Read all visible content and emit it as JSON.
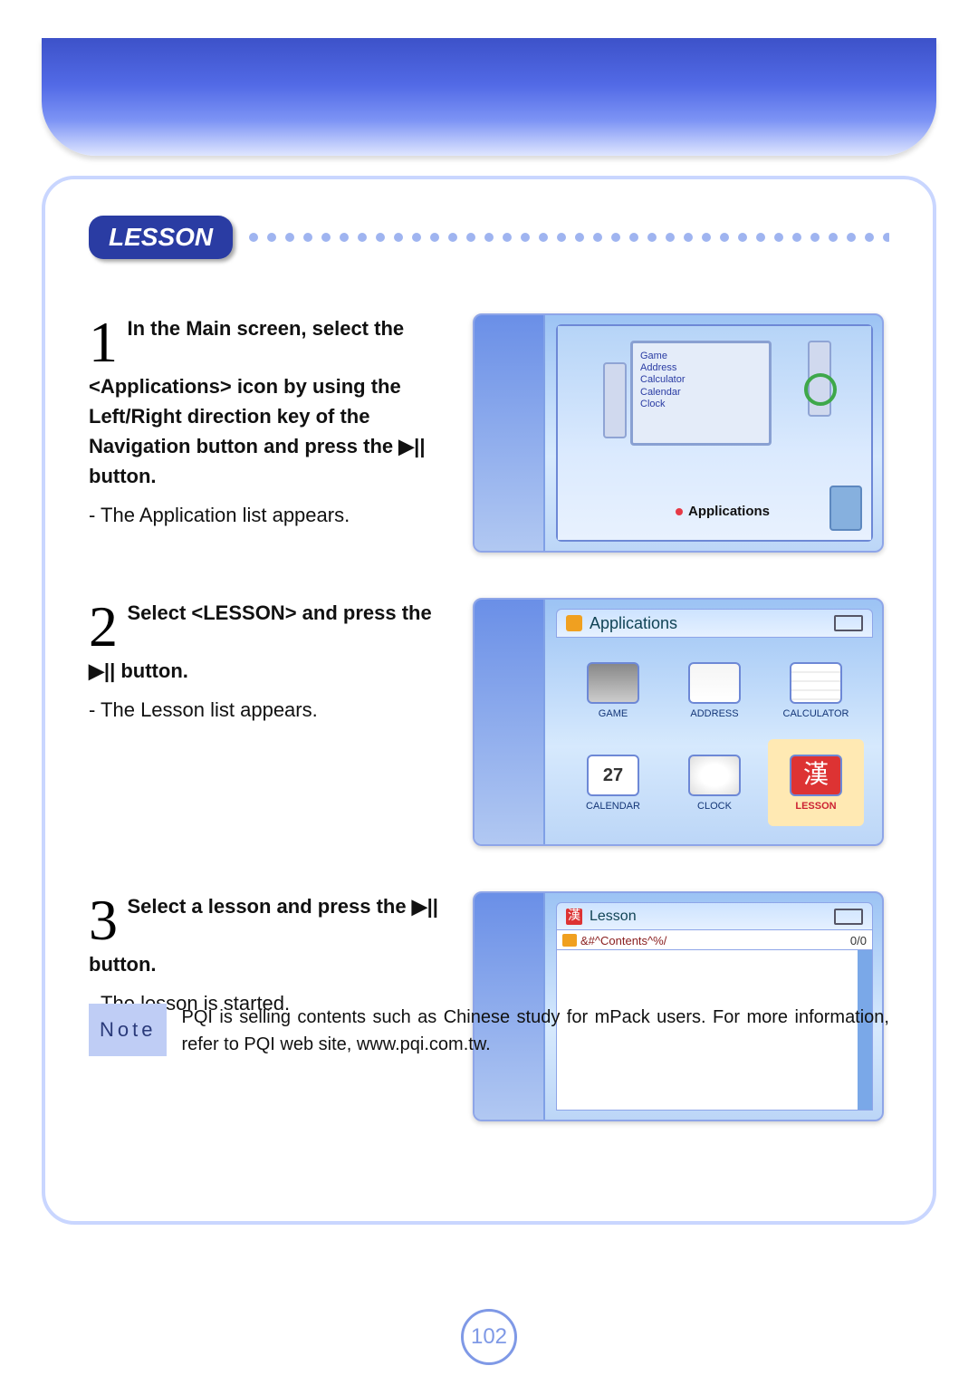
{
  "header_badge": "LESSON",
  "page_number": "102",
  "steps": [
    {
      "number": "1",
      "title_parts": [
        "In the Main screen, select the <Applications> icon by using the Left/Right direction key of the Navigation button and press the ",
        "▶||",
        " button."
      ],
      "sub": "- The Application list appears.",
      "device": {
        "menu_text": "Game\nAddress\nCalculator\nCalendar\nClock",
        "tag": "Applications"
      }
    },
    {
      "number": "2",
      "title_parts": [
        "Select <LESSON> and press the ",
        "▶||",
        " button."
      ],
      "sub": "- The Lesson list appears.",
      "device": {
        "title": "Applications",
        "items": [
          {
            "label": "GAME"
          },
          {
            "label": "ADDRESS"
          },
          {
            "label": "CALCULATOR"
          },
          {
            "label": "CALENDAR",
            "num": "27"
          },
          {
            "label": "CLOCK"
          },
          {
            "label": "LESSON",
            "han": "漢",
            "selected": true
          }
        ]
      }
    },
    {
      "number": "3",
      "title_parts": [
        "Select a lesson and press the ",
        "▶||",
        " button."
      ],
      "sub": "- The lesson is started.",
      "device": {
        "title": "Lesson",
        "path": "&#^Contents^%/",
        "count": "0/0"
      }
    }
  ],
  "note": {
    "label": "Note",
    "text": "PQI is selling contents such as Chinese study for mPack users. For more information, refer to PQI web site, www.pqi.com.tw."
  }
}
